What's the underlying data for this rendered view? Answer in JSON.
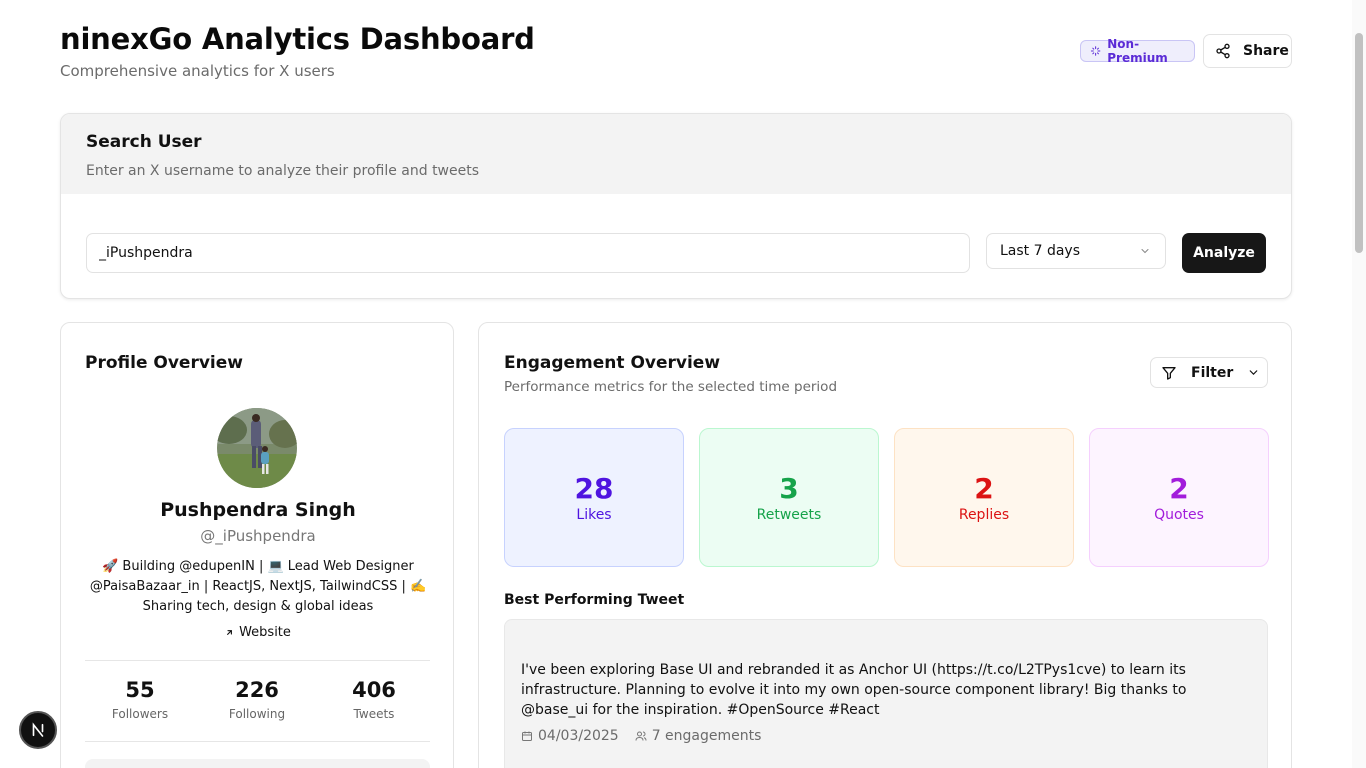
{
  "header": {
    "title": "ninexGo Analytics Dashboard",
    "subtitle": "Comprehensive analytics for X users",
    "badge": "Non-Premium",
    "share_label": "Share"
  },
  "search": {
    "title": "Search User",
    "description": "Enter an X username to analyze their profile and tweets",
    "input_value": "_iPushpendra",
    "period": "Last 7 days",
    "analyze_label": "Analyze"
  },
  "profile": {
    "title": "Profile Overview",
    "name": "Pushpendra Singh",
    "handle": "@_iPushpendra",
    "bio": "🚀 Building @edupenIN | 💻 Lead Web Designer @PaisaBazaar_in | ReactJS, NextJS, TailwindCSS | ✍️ Sharing tech, design & global ideas",
    "website_label": "Website",
    "stats": [
      {
        "value": "55",
        "label": "Followers"
      },
      {
        "value": "226",
        "label": "Following"
      },
      {
        "value": "406",
        "label": "Tweets"
      }
    ]
  },
  "engagement": {
    "title": "Engagement Overview",
    "description": "Performance metrics for the selected time period",
    "filter_label": "Filter",
    "metrics": [
      {
        "value": "28",
        "label": "Likes",
        "color": "#4f14e0",
        "bg": "#eef2ff",
        "border": "#c7d2fe"
      },
      {
        "value": "3",
        "label": "Retweets",
        "color": "#16a34a",
        "bg": "#ecfdf3",
        "border": "#bbf7d0"
      },
      {
        "value": "2",
        "label": "Replies",
        "color": "#dc1313",
        "bg": "#fff7ed",
        "border": "#fde2c4"
      },
      {
        "value": "2",
        "label": "Quotes",
        "color": "#a21cdb",
        "bg": "#fdf4ff",
        "border": "#f5d0fe"
      }
    ],
    "best_label": "Best Performing Tweet",
    "tweet": {
      "text": "I've been exploring Base UI and rebranded it as Anchor UI (https://t.co/L2TPys1cve) to learn its infrastructure. Planning to evolve it into my own open-source component library! Big thanks to @base_ui for the inspiration. #OpenSource #React",
      "date": "04/03/2025",
      "engagements": "7 engagements"
    }
  },
  "icons": [
    "sparkles-icon",
    "share-icon",
    "chevron-down-icon",
    "arrow-up-right-icon",
    "filter-icon",
    "calendar-icon",
    "users-icon",
    "nextjs-logo-icon"
  ]
}
